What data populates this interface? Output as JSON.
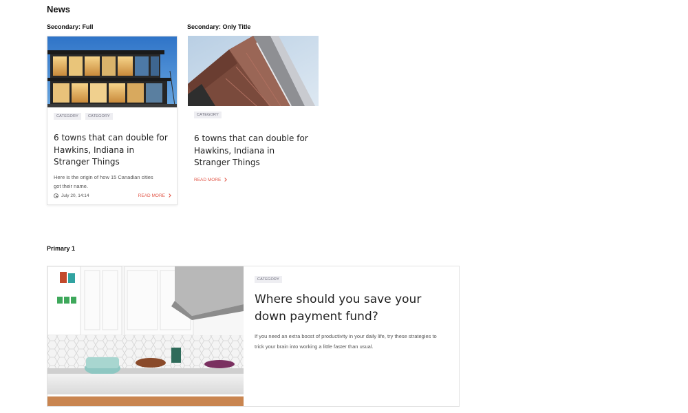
{
  "page": {
    "section_title": "News"
  },
  "secondary_full": {
    "label": "Secondary: Full",
    "categories": [
      "CATEGORY",
      "CATEGORY"
    ],
    "title": "6 towns that can double for Hawkins, Indiana in Stranger Things",
    "excerpt": "Here is the origin of how 15 Canadian cities got their name.",
    "date": "July 20, 14:14",
    "read_more": "READ MORE"
  },
  "secondary_title": {
    "label": "Secondary: Only Title",
    "categories": [
      "CATEGORY"
    ],
    "title": "6 towns that can double for Hawkins, Indiana in Stranger Things",
    "read_more": "READ MORE"
  },
  "primary": {
    "label": "Primary 1",
    "categories": [
      "CATEGORY"
    ],
    "title": "Where should you save your down payment fund?",
    "excerpt": "If you need an extra boost of productivity in your daily life, try these strategies to trick your brain into working a little faster than usual."
  },
  "colors": {
    "accent": "#e2584a",
    "tag_bg": "#eeeef2"
  },
  "icons": {
    "date": "clock-icon",
    "read_more": "chevron-right-icon"
  }
}
